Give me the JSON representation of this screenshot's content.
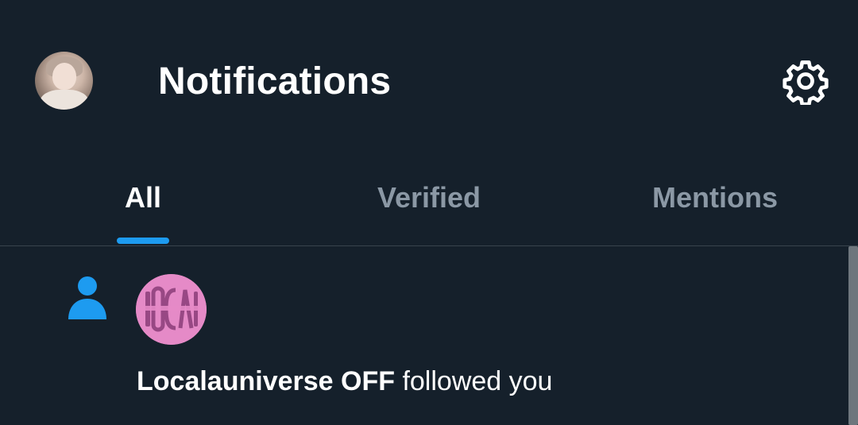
{
  "header": {
    "title": "Notifications",
    "avatar_icon": "profile-avatar",
    "settings_icon": "gear-icon"
  },
  "tabs": [
    {
      "label": "All",
      "active": true
    },
    {
      "label": "Verified",
      "active": false
    },
    {
      "label": "Mentions",
      "active": false
    }
  ],
  "notifications": [
    {
      "type": "follow",
      "icon": "person-icon",
      "user_name": "Localauniverse OFF",
      "action_text": " followed you",
      "avatar_logo_text": "LOCAL"
    }
  ],
  "colors": {
    "background": "#15202b",
    "accent": "#1d9bf0",
    "muted_text": "#8b98a5",
    "divider": "#38444d",
    "follower_avatar": "#e58ac7"
  }
}
